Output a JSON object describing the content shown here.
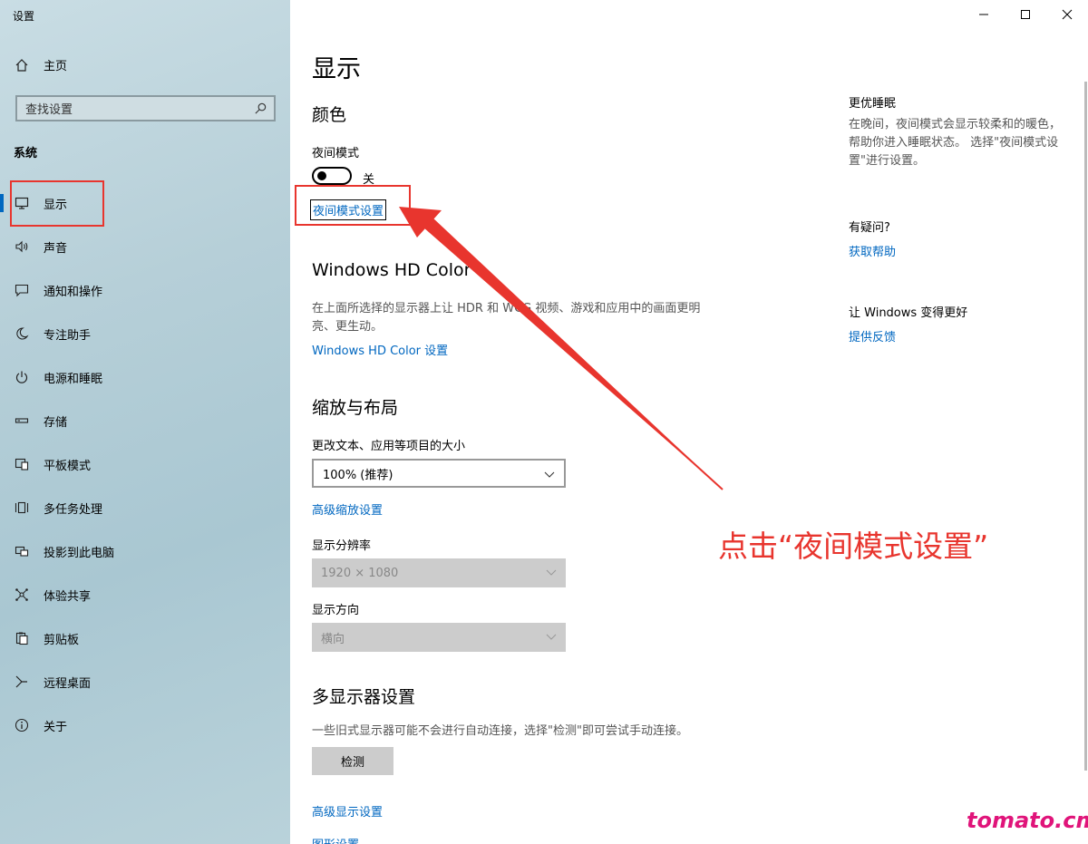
{
  "window": {
    "title": "设置"
  },
  "sidebar": {
    "home_label": "主页",
    "search_placeholder": "查找设置",
    "section_label": "系统",
    "items": [
      {
        "label": "显示",
        "icon": "monitor-icon",
        "active": true
      },
      {
        "label": "声音",
        "icon": "speaker-icon"
      },
      {
        "label": "通知和操作",
        "icon": "message-icon"
      },
      {
        "label": "专注助手",
        "icon": "moon-icon"
      },
      {
        "label": "电源和睡眠",
        "icon": "power-icon"
      },
      {
        "label": "存储",
        "icon": "drive-icon"
      },
      {
        "label": "平板模式",
        "icon": "tablet-icon"
      },
      {
        "label": "多任务处理",
        "icon": "multitask-icon"
      },
      {
        "label": "投影到此电脑",
        "icon": "project-icon"
      },
      {
        "label": "体验共享",
        "icon": "share-icon"
      },
      {
        "label": "剪贴板",
        "icon": "clipboard-icon"
      },
      {
        "label": "远程桌面",
        "icon": "remote-icon"
      },
      {
        "label": "关于",
        "icon": "info-icon"
      }
    ]
  },
  "main": {
    "title": "显示",
    "color_heading": "颜色",
    "night_mode_label": "夜间模式",
    "night_mode_state": "关",
    "night_mode_settings_link": "夜间模式设置",
    "hd_heading": "Windows HD Color",
    "hd_desc": "在上面所选择的显示器上让 HDR 和 WCG 视频、游戏和应用中的画面更明亮、更生动。",
    "hd_link": "Windows HD Color 设置",
    "scale_heading": "缩放与布局",
    "scale_label": "更改文本、应用等项目的大小",
    "scale_value": "100% (推荐)",
    "advanced_scale_link": "高级缩放设置",
    "resolution_label": "显示分辨率",
    "resolution_value": "1920 × 1080",
    "orientation_label": "显示方向",
    "orientation_value": "横向",
    "multi_heading": "多显示器设置",
    "multi_desc": "一些旧式显示器可能不会进行自动连接，选择\"检测\"即可尝试手动连接。",
    "detect_button": "检测",
    "advanced_display_link": "高级显示设置",
    "graphics_link": "图形设置"
  },
  "right": {
    "sleep_title": "更优睡眠",
    "sleep_desc": "在晚间，夜间模式会显示较柔和的暖色，帮助你进入睡眠状态。 选择\"夜间模式设置\"进行设置。",
    "question_title": "有疑问?",
    "help_link": "获取帮助",
    "improve_title": "让 Windows 变得更好",
    "feedback_link": "提供反馈"
  },
  "annotation": {
    "text": "点击“夜间模式设置”",
    "color": "#e8352e",
    "watermark": "tomato.cm"
  },
  "colors": {
    "accent": "#0067c0",
    "highlight": "#e8352e"
  }
}
